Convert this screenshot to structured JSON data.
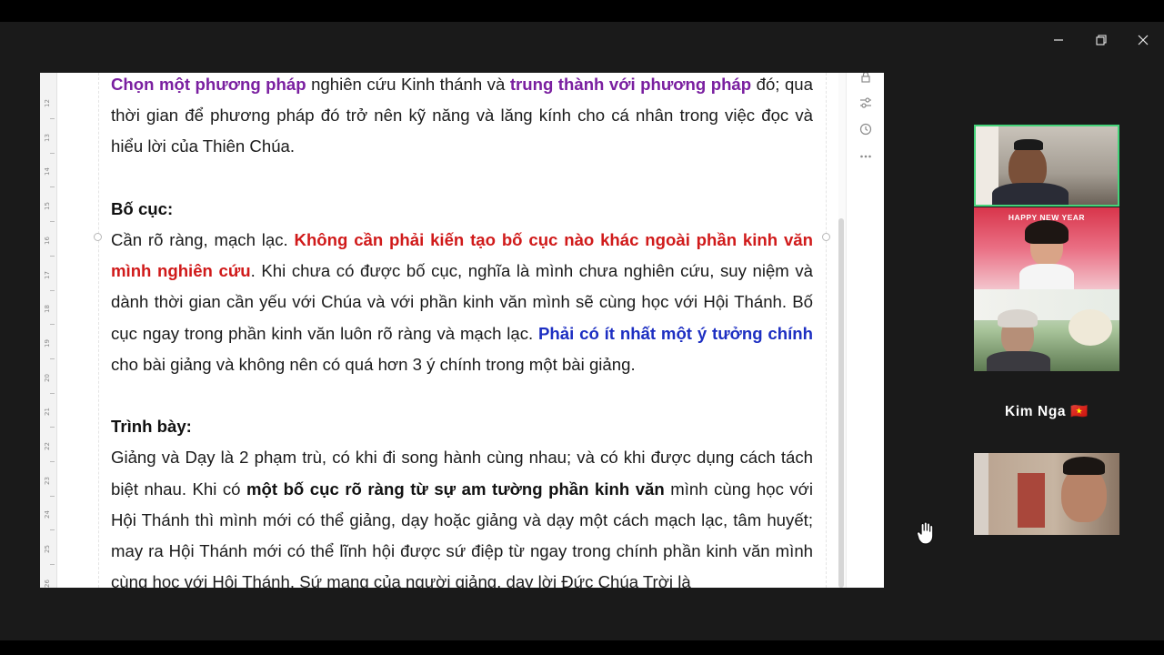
{
  "window_controls": {
    "minimize": "minimize-icon",
    "restore": "restore-icon",
    "close": "close-icon"
  },
  "ruler": {
    "numbers": [
      "12",
      "13",
      "14",
      "15",
      "16",
      "17",
      "18",
      "19",
      "20",
      "21",
      "22",
      "23",
      "24",
      "25",
      "26"
    ]
  },
  "document": {
    "para1": {
      "s1": "Chọn một phương pháp",
      "s2": " nghiên cứu Kinh thánh và ",
      "s3": "trung thành với phương pháp",
      "s4": " đó; qua thời gian để phương pháp đó trở nên kỹ năng và lăng kính cho cá nhân trong việc đọc và hiểu lời của Thiên Chúa."
    },
    "heading_bocuc": "Bố cục:",
    "para2": {
      "s1": "Cần rõ ràng, mạch lạc. ",
      "s2": "Không cần phải kiến tạo bố cục nào khác ngoài phần kinh văn mình nghiên cứu",
      "s3": ". Khi chưa có được bố cục, nghĩa là mình chưa nghiên cứu, suy niệm và dành thời gian cần yếu với Chúa và với phần kinh văn mình sẽ cùng học với Hội Thánh. Bố cục ngay trong phần kinh văn luôn rõ ràng và mạch lạc. ",
      "s4": "Phải có ít nhất một ý tưởng chính",
      "s5": " cho bài giảng và không nên có quá hơn 3 ý chính trong một bài giảng."
    },
    "heading_trinhbay": "Trình bày:",
    "para3": {
      "s1": "Giảng và Dạy là 2 phạm trù, có khi đi song hành cùng nhau; và có khi được dụng cách tách biệt nhau. Khi có ",
      "s2": "một bố cục rõ ràng từ sự am tường phần kinh văn",
      "s3": " mình cùng học với Hội Thánh thì mình mới có thể giảng, dạy hoặc giảng và dạy một cách mạch lạc, tâm huyết; may ra Hội Thánh mới có thể lĩnh hội được sứ điệp từ ngay trong chính phần kinh văn mình cùng học với Hội Thánh. Sứ mạng của người giảng, dạy lời Đức Chúa Trời là"
    },
    "colors": {
      "purple": "#7a1fa0",
      "red": "#d01a1a",
      "blue": "#1d2fc2"
    }
  },
  "side_tools": [
    "lock-icon",
    "sliders-icon",
    "history-icon",
    "more-icon"
  ],
  "participants": {
    "banner_text": "HAPPY NEW YEAR",
    "active_speaker_color": "#45d37a",
    "name_label": "Kim Nga 🇻🇳"
  },
  "cursor": "raise-hand-icon"
}
